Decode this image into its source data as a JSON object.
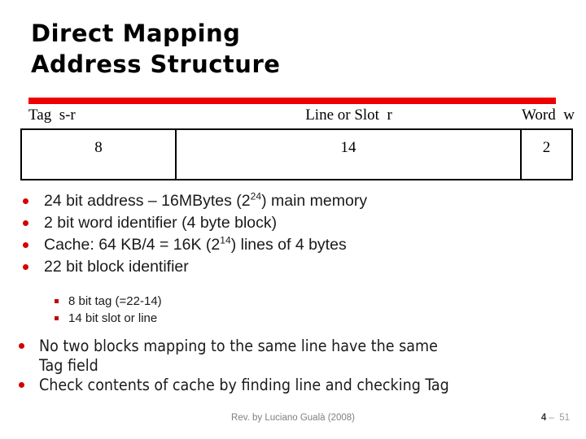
{
  "slide": {
    "title_lines": [
      "Direct Mapping",
      "Address Structure"
    ],
    "divider_color": "#ED0000"
  },
  "address_structure": {
    "headers": {
      "tag": "Tag  s-r",
      "line": "Line or Slot  r",
      "word": "Word  w"
    },
    "bits": {
      "tag": "8",
      "line": "14",
      "word": "2"
    }
  },
  "bullets": [
    {
      "pre": "24 bit address – 16MBytes (2",
      "sup": "24",
      "post": ") main memory"
    },
    {
      "pre": "2 bit word identifier (4 byte block)",
      "sup": "",
      "post": ""
    },
    {
      "pre": "Cache: 64 KB/4 = 16K (2",
      "sup": "14",
      "post": ") lines of 4 bytes"
    },
    {
      "pre": "22 bit block identifier",
      "sup": "",
      "post": ""
    }
  ],
  "sub_bullets": [
    "8 bit tag (=22-14)",
    "14 bit slot or line"
  ],
  "lower_bullets": [
    {
      "line1": "No two blocks mapping to the same line have the same",
      "line2": "Tag field"
    },
    {
      "line1": "Check contents of cache by finding line and checking Tag",
      "line2": ""
    }
  ],
  "footer": {
    "credit": "Rev. by Luciano Gualà (2008)",
    "page_number": "4",
    "page_separator": " –  ",
    "page_total": "51"
  },
  "colors": {
    "bullet_red": "#D40000",
    "divider_red": "#ED0000",
    "text": "#1a1a1a",
    "footer_gray": "#808080"
  }
}
